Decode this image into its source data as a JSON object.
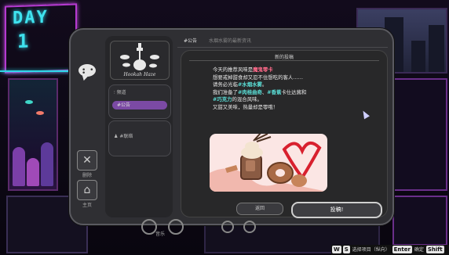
{
  "background": {
    "neon_day": "DAY",
    "neon_number": "1"
  },
  "sidebar": {
    "delete_icon": "close-icon",
    "delete_label": "删除",
    "home_icon": "home-icon",
    "home_label": "主页"
  },
  "left_panel": {
    "logo_text": "Hookah Haze",
    "channels_header": "频道",
    "channel_items": [
      "#公告"
    ],
    "dm_header": "#联络"
  },
  "tabs": [
    "#公告",
    "水烟水雾的最新资讯"
  ],
  "post": {
    "title": "新的投稿",
    "line1_pre": "今天的推荐风味是",
    "line1_hl": "魔鬼零卡",
    "line2": "想要戒掉甜食却又忍不住想吃的客人……",
    "line3_pre": "请务必光临",
    "line3_hl": "#水烟水雾",
    "line3_post": "。",
    "line4_pre": "我们准备了",
    "line4_hl1": "#肉桂曲奇",
    "line4_mid": "、",
    "line4_hl2": "#香蕉",
    "line4_post": "卡仕达酱和",
    "line5_hl": "#巧克力",
    "line5_post": "的混合风味。",
    "line6": "又甜又美味，热量却是零哦！",
    "return_label": "返回",
    "submit_label": "投稿!"
  },
  "music": {
    "label": "音乐"
  },
  "controls": {
    "key_w": "W",
    "key_s": "S",
    "text_select": "选择项目（纵向）",
    "key_enter": "Enter",
    "text_confirm": "确定",
    "key_shift": "Shift"
  },
  "colors": {
    "accent_purple": "#7b4aa4",
    "highlight_red": "#ff6a8a",
    "highlight_cyan": "#5be0d8",
    "neon_cyan": "#3fe3ef",
    "neon_magenta": "#c24ee0"
  }
}
